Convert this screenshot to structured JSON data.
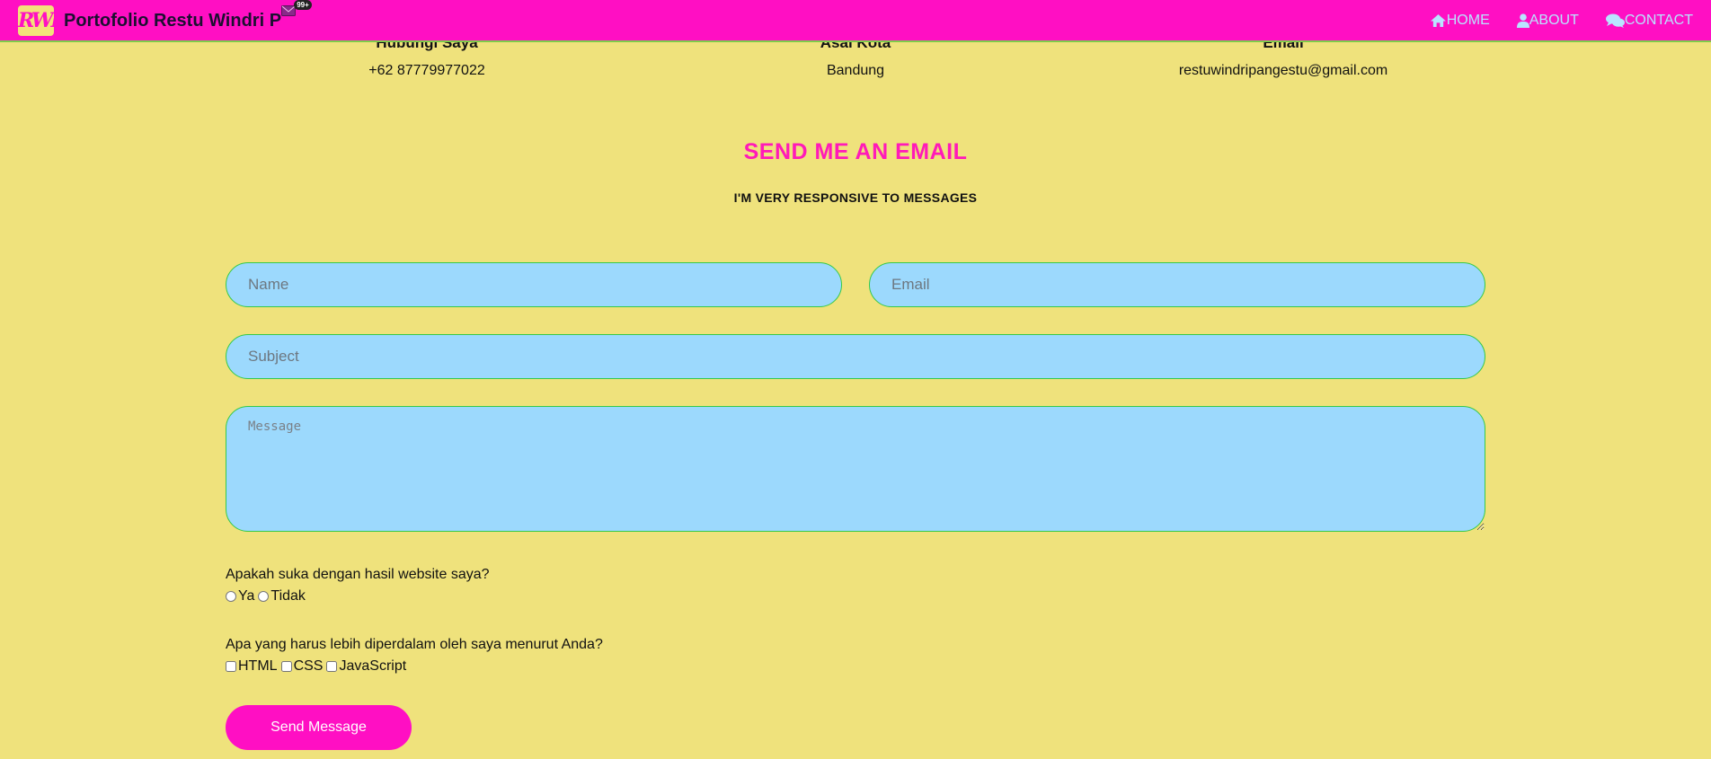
{
  "navbar": {
    "logo_text": "RWP",
    "brand": "Portofolio Restu Windri P",
    "notification_count": "99+",
    "links": [
      {
        "label": "HOME",
        "icon": "home-icon"
      },
      {
        "label": "ABOUT",
        "icon": "user-icon"
      },
      {
        "label": "CONTACT",
        "icon": "chat-icon"
      }
    ],
    "colors": {
      "background": "#ff0fc3",
      "link": "#b9e4ff"
    }
  },
  "contact_info": [
    {
      "heading": "Hubungi Saya",
      "value": "+62 87779977022"
    },
    {
      "heading": "Asal Kota",
      "value": "Bandung"
    },
    {
      "heading": "Email",
      "value": "restuwindripangestu@gmail.com"
    }
  ],
  "section": {
    "title": "SEND ME AN EMAIL",
    "subtitle": "I'M VERY RESPONSIVE TO MESSAGES"
  },
  "form": {
    "name_placeholder": "Name",
    "email_placeholder": "Email",
    "subject_placeholder": "Subject",
    "message_placeholder": "Message",
    "question1": "Apakah suka dengan hasil website saya?",
    "question1_options": [
      "Ya",
      "Tidak"
    ],
    "question2": "Apa yang harus lebih diperdalam oleh saya menurut Anda?",
    "question2_options": [
      "HTML",
      "CSS",
      "JavaScript"
    ],
    "submit_label": "Send Message"
  },
  "colors": {
    "page_background": "#efe27c",
    "accent": "#ff0fc3",
    "field_background": "#9cd9fd",
    "field_border": "#35c94a"
  }
}
